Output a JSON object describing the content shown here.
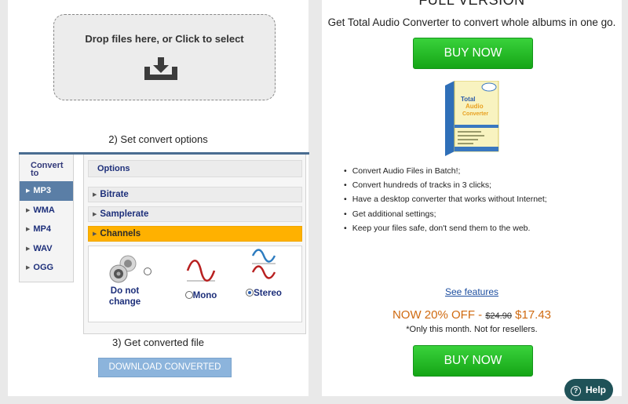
{
  "left": {
    "dropzone_text": "Drop files here, or Click to select",
    "step2": "2) Set convert options",
    "step3": "3) Get converted file",
    "converter": {
      "format_header": "Convert to",
      "formats": [
        "MP3",
        "WMA",
        "MP4",
        "WAV",
        "OGG"
      ],
      "active_format": "MP3",
      "options_header": "Options",
      "options": [
        "Bitrate",
        "Samplerate",
        "Channels"
      ],
      "active_option": "Channels",
      "channels": {
        "do_not_change": "Do not change",
        "mono": "Mono",
        "stereo": "Stereo",
        "selected": "Stereo"
      }
    },
    "download_button": "DOWNLOAD CONVERTED FILE"
  },
  "right": {
    "title": "FULL VERSION",
    "subtitle": "Get Total Audio Converter to convert whole albums in one go.",
    "buy_button": "BUY NOW",
    "box_text": {
      "line1": "Total",
      "line2": "Audio",
      "line3": "Converter"
    },
    "features": [
      "Convert Audio Files in Batch!;",
      "Convert hundreds of tracks in 3 clicks;",
      "Have a desktop converter that works without Internet;",
      "Get additional settings;",
      "Keep your files safe, don't send them to the web."
    ],
    "see_features": "See features",
    "offer": "NOW 20% OFF -",
    "old_price": "$24.90",
    "new_price": "$17.43",
    "note": "*Only this month. Not for resellers."
  },
  "help": {
    "label": "Help"
  },
  "colors": {
    "buy_green": "#1fb821",
    "channels_orange": "#ffb100",
    "format_active": "#5a7ea6",
    "download_blue": "#8cb4dc",
    "help_teal": "#1f5258",
    "price_orange": "#d06a10"
  },
  "icons": [
    "download-tray-icon",
    "speaker-icon",
    "mono-wave-icon",
    "stereo-wave-icon",
    "help-question-icon"
  ]
}
